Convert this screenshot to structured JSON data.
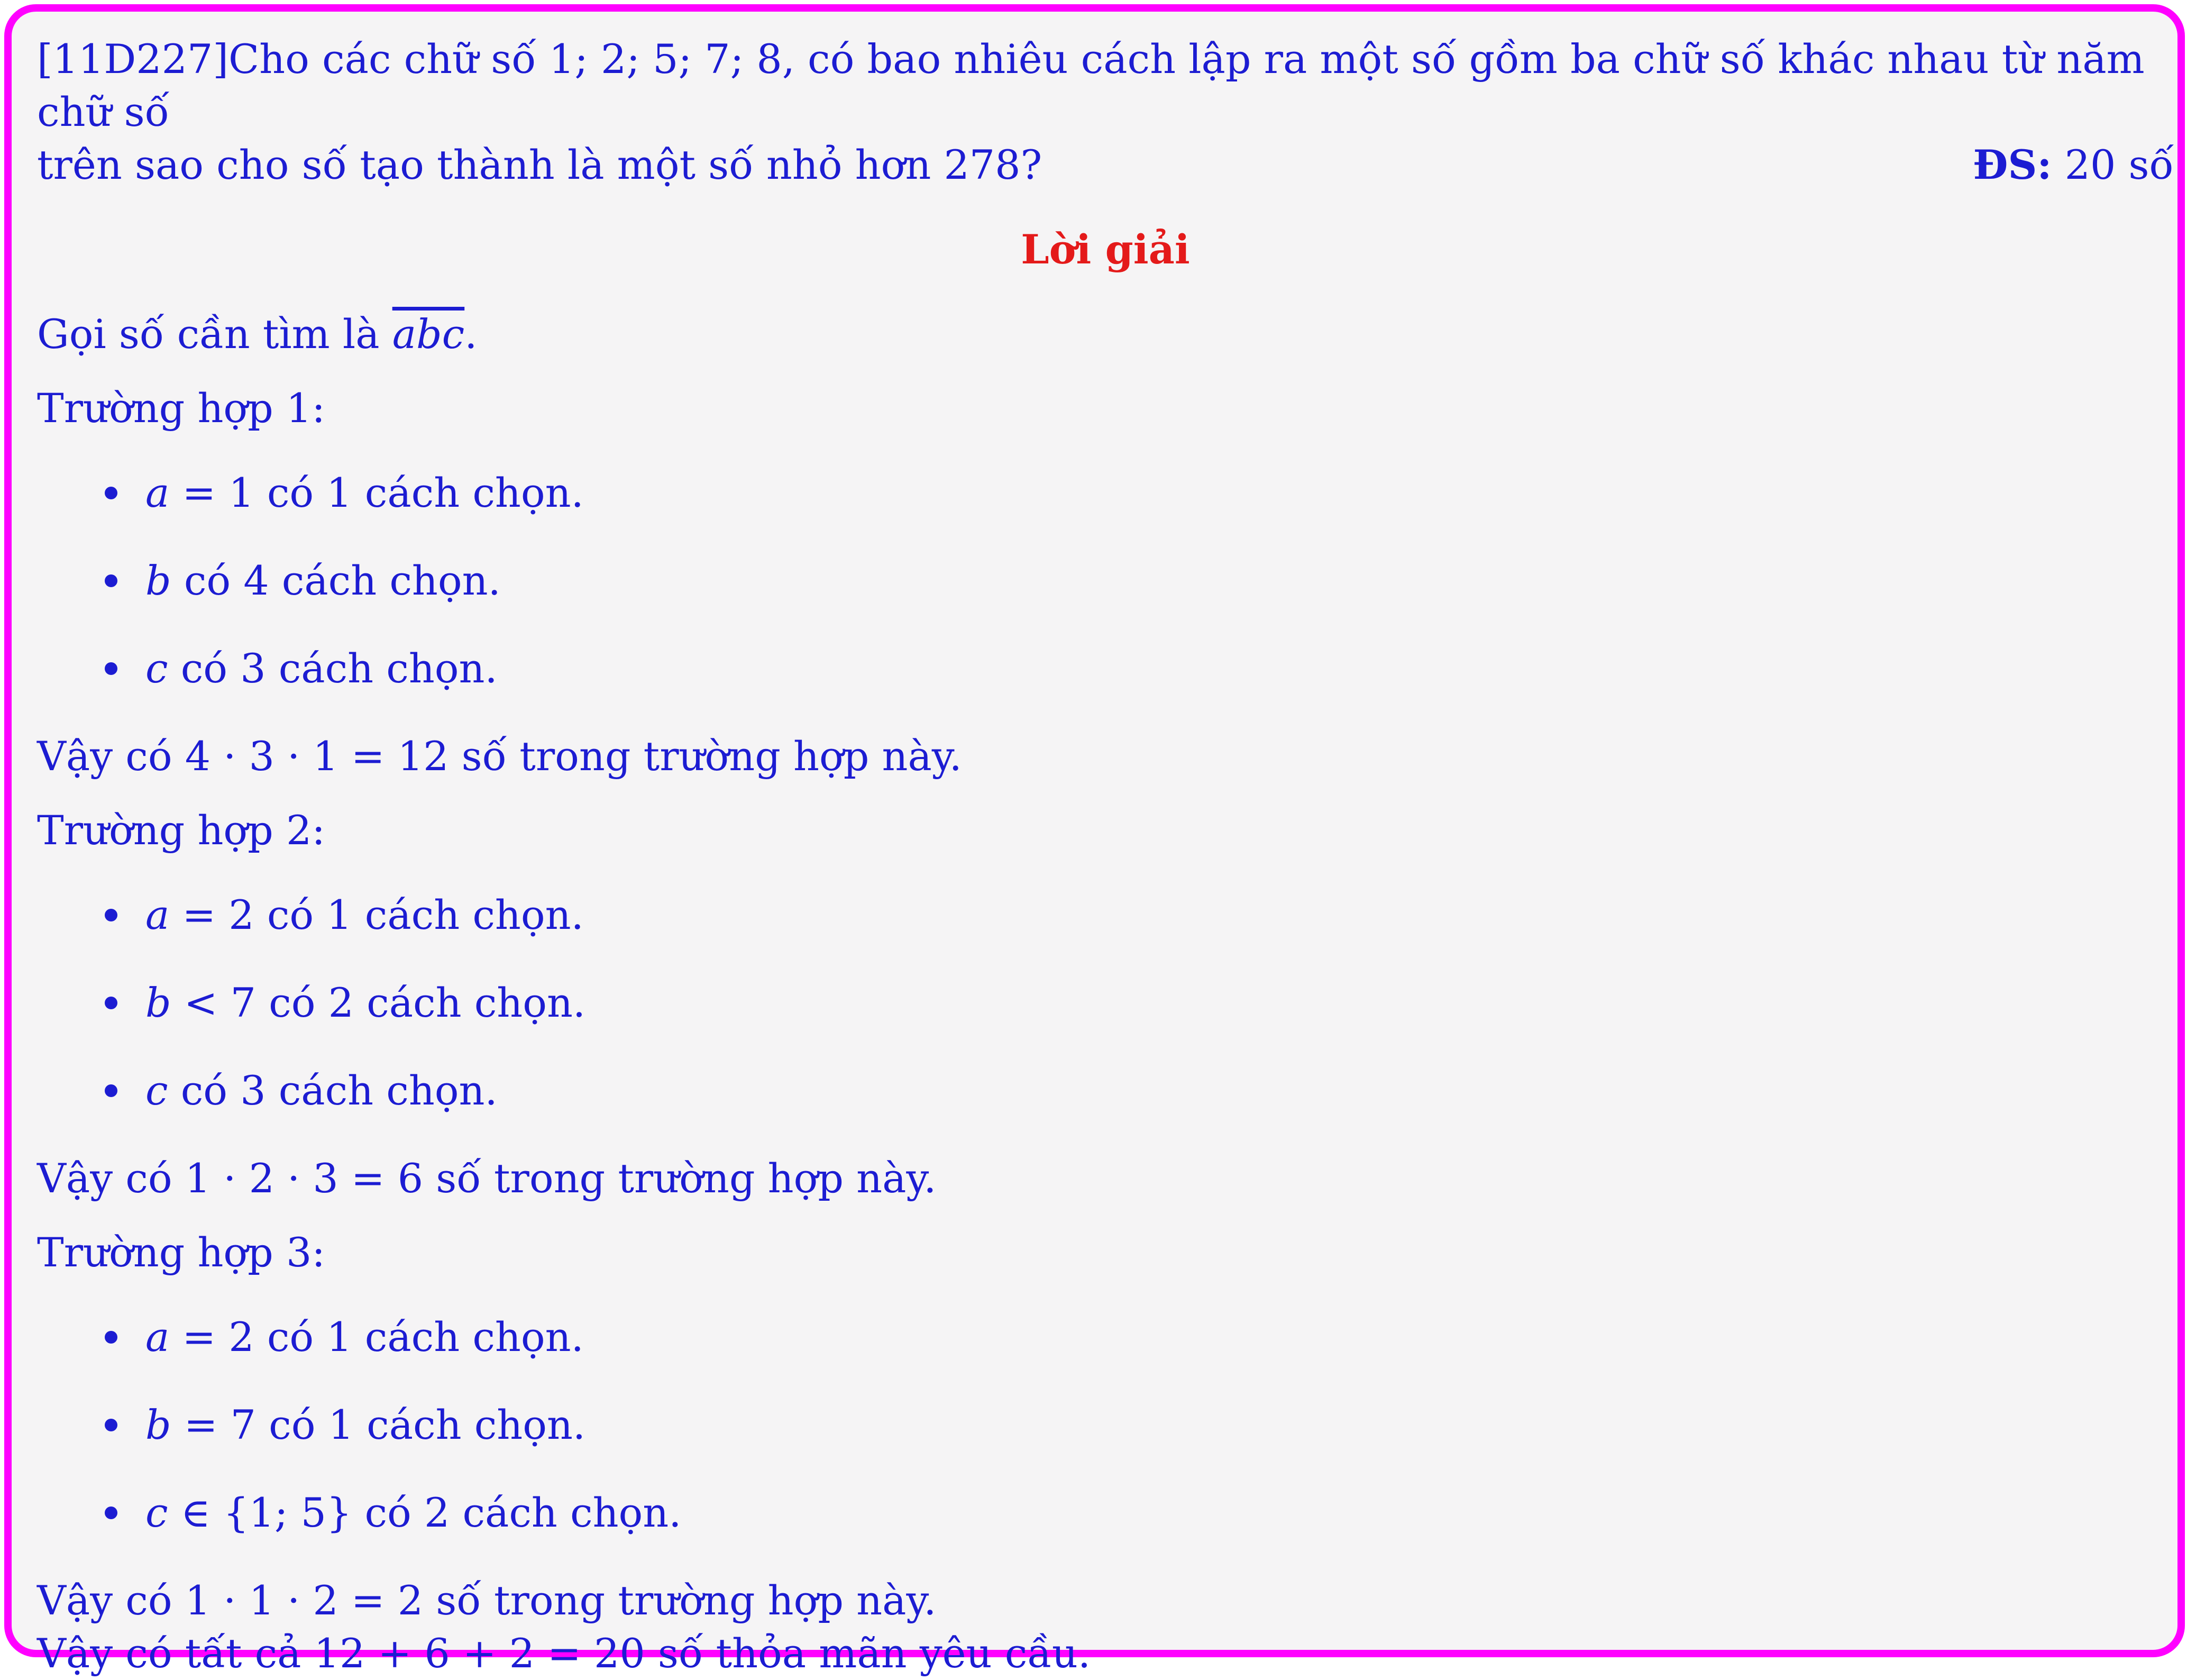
{
  "problem": {
    "line1": "[11D227]Cho các chữ số 1; 2; 5; 7; 8, có bao nhiêu cách lập ra một số gồm ba chữ số khác nhau từ năm chữ số",
    "line2": "trên sao cho số tạo thành là một số nhỏ hơn 278?",
    "answer_label": "ĐS:",
    "answer_value": " 20 số"
  },
  "solution": {
    "title": "Lời giải",
    "intro": "Gọi số cần tìm là ",
    "intro_var": "abc",
    "intro_end": ".",
    "cases": [
      {
        "title": "Trường hợp 1:",
        "items": [
          {
            "var": "a",
            "text": " = 1 có 1 cách chọn."
          },
          {
            "var": "b",
            "text": " có 4 cách chọn."
          },
          {
            "var": "c",
            "text": " có 3 cách chọn."
          }
        ],
        "conclusion": "Vậy có 4 · 3 · 1 = 12 số trong trường hợp này."
      },
      {
        "title": "Trường hợp 2:",
        "items": [
          {
            "var": "a",
            "text": " = 2 có 1 cách chọn."
          },
          {
            "var": "b",
            "text": " < 7 có 2 cách chọn."
          },
          {
            "var": "c",
            "text": " có 3 cách chọn."
          }
        ],
        "conclusion": "Vậy có 1 · 2 · 3 = 6 số trong trường hợp này."
      },
      {
        "title": "Trường hợp 3:",
        "items": [
          {
            "var": "a",
            "text": " = 2 có 1 cách chọn."
          },
          {
            "var": "b",
            "text": " = 7 có 1 cách chọn."
          },
          {
            "var": "c",
            "text": " ∈ {1; 5} có 2 cách chọn."
          }
        ],
        "conclusion": "Vậy có 1 · 1 · 2 = 2 số trong trường hợp này."
      }
    ],
    "final": "Vậy có tất cả 12 + 6 + 2 = 20 số thỏa mãn yêu cầu."
  },
  "colors": {
    "text": "#1c1cd2",
    "title": "#e41a1a",
    "border": "#ff00ff",
    "background": "#f5f4f5"
  }
}
